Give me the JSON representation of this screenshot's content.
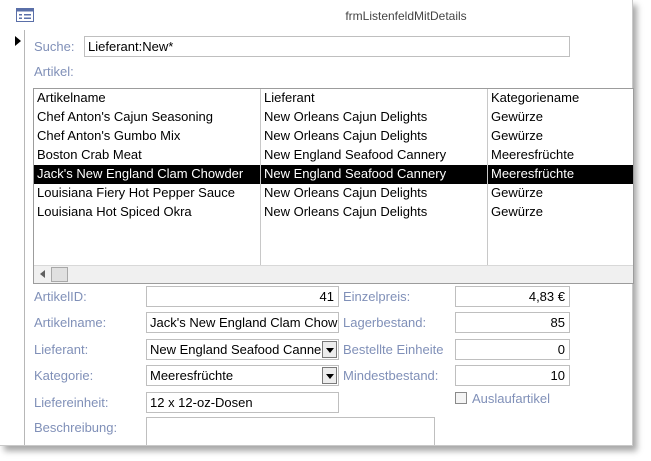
{
  "window": {
    "title": "frmListenfeldMitDetails"
  },
  "search": {
    "label": "Suche:",
    "value": "Lieferant:New*"
  },
  "articles": {
    "label": "Artikel:",
    "columns": [
      "Artikelname",
      "Lieferant",
      "Kategoriename"
    ],
    "rows": [
      [
        "Chef Anton's Cajun Seasoning",
        "New Orleans Cajun Delights",
        "Gewürze"
      ],
      [
        "Chef Anton's Gumbo Mix",
        "New Orleans Cajun Delights",
        "Gewürze"
      ],
      [
        "Boston Crab Meat",
        "New England Seafood Cannery",
        "Meeresfrüchte"
      ],
      [
        "Jack's New England Clam Chowder",
        "New England Seafood Cannery",
        "Meeresfrüchte"
      ],
      [
        "Louisiana Fiery Hot Pepper Sauce",
        "New Orleans Cajun Delights",
        "Gewürze"
      ],
      [
        "Louisiana Hot Spiced Okra",
        "New Orleans Cajun Delights",
        "Gewürze"
      ]
    ],
    "selected_index": 3
  },
  "details": {
    "artikelid_label": "ArtikelID:",
    "artikelid_value": "41",
    "artikelname_label": "Artikelname:",
    "artikelname_value": "Jack's New England Clam Chow",
    "lieferant_label": "Lieferant:",
    "lieferant_value": "New England Seafood Canne",
    "kategorie_label": "Kategorie:",
    "kategorie_value": "Meeresfrüchte",
    "liefereinheit_label": "Liefereinheit:",
    "liefereinheit_value": "12 x 12-oz-Dosen",
    "beschreibung_label": "Beschreibung:",
    "beschreibung_value": "",
    "einzelpreis_label": "Einzelpreis:",
    "einzelpreis_value": "4,83 €",
    "lagerbestand_label": "Lagerbestand:",
    "lagerbestand_value": "85",
    "bestellte_label": "Bestellte Einheite",
    "bestellte_value": "0",
    "mindestbestand_label": "Mindestbestand:",
    "mindestbestand_value": "10",
    "auslaufartikel_label": "Auslaufartikel",
    "auslaufartikel_checked": false
  },
  "colors": {
    "label": "#8090b8",
    "selected_row_bg": "#000000",
    "selected_row_fg": "#ffffff"
  }
}
